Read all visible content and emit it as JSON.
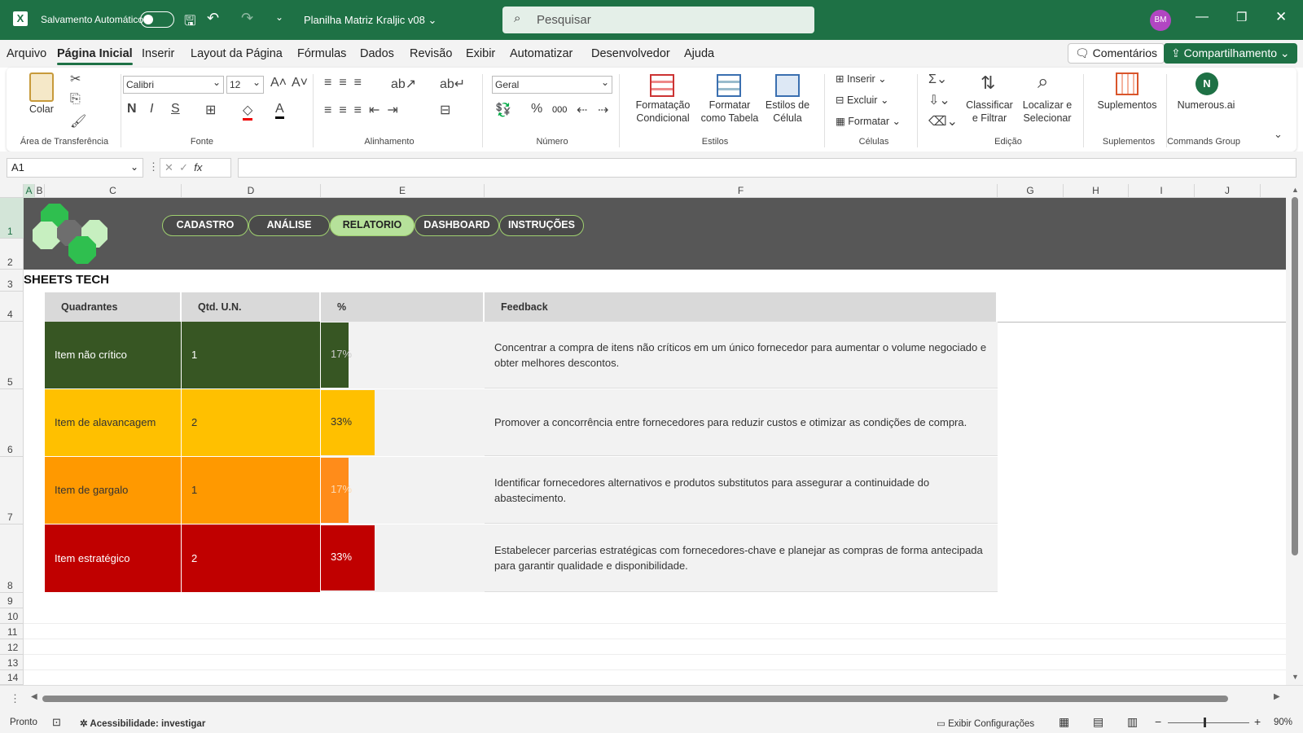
{
  "titlebar": {
    "autosave_label": "Salvamento Automático",
    "file_name": "Planilha Matriz Kraljic v08",
    "search_placeholder": "Pesquisar",
    "avatar_initials": "BM"
  },
  "tabs": [
    "Arquivo",
    "Página Inicial",
    "Inserir",
    "Layout da Página",
    "Fórmulas",
    "Dados",
    "Revisão",
    "Exibir",
    "Automatizar",
    "Desenvolvedor",
    "Ajuda"
  ],
  "top_buttons": {
    "comments": "Comentários",
    "share": "Compartilhamento"
  },
  "ribbon": {
    "clipboard": {
      "paste": "Colar",
      "label": "Área de Transferência"
    },
    "font": {
      "name": "Calibri",
      "size": "12",
      "label": "Fonte",
      "bold": "N",
      "italic": "I",
      "underline": "S"
    },
    "alignment": {
      "label": "Alinhamento"
    },
    "number": {
      "format": "Geral",
      "label": "Número",
      "percent": "%",
      "thousands": "000"
    },
    "styles": {
      "conditional": "Formatação Condicional",
      "table": "Formatar como Tabela",
      "cell_styles": "Estilos de Célula",
      "label": "Estilos"
    },
    "cells": {
      "insert": "Inserir",
      "delete": "Excluir",
      "format": "Formatar",
      "label": "Células"
    },
    "editing": {
      "sort": "Classificar e Filtrar",
      "find": "Localizar e Selecionar",
      "label": "Edição"
    },
    "addins": {
      "addins": "Suplementos",
      "label": "Suplementos"
    },
    "commands": {
      "numerous": "Numerous.ai",
      "label": "Commands Group"
    }
  },
  "formula_bar": {
    "name_box": "A1",
    "fx": "fx",
    "value": ""
  },
  "columns": [
    "A",
    "B",
    "C",
    "D",
    "E",
    "F",
    "G",
    "H",
    "I",
    "J"
  ],
  "rows": [
    "1",
    "2",
    "3",
    "4",
    "5",
    "6",
    "7",
    "8",
    "9",
    "10",
    "11",
    "12",
    "13",
    "14"
  ],
  "sheet": {
    "brand": "SHEETS TECH",
    "nav": [
      "CADASTRO",
      "ANÁLISE",
      "RELATORIO",
      "DASHBOARD",
      "INSTRUÇÕES"
    ],
    "active_nav": "RELATORIO",
    "headers": {
      "quadrant": "Quadrantes",
      "qty": "Qtd. U.N.",
      "pct": "%",
      "feedback": "Feedback"
    },
    "items": [
      {
        "name": "Item não crítico",
        "qty": "1",
        "pct": "17%",
        "pct_value": 17,
        "color": "#375623",
        "feedback": "Concentrar a compra de itens não críticos em um único fornecedor para aumentar o volume negociado e obter melhores descontos."
      },
      {
        "name": "Item de alavancagem",
        "qty": "2",
        "pct": "33%",
        "pct_value": 33,
        "color": "#ffc000",
        "feedback": "Promover a concorrência entre fornecedores para reduzir custos e otimizar as condições de compra."
      },
      {
        "name": "Item de gargalo",
        "qty": "1",
        "pct": "17%",
        "pct_value": 17,
        "color": "#ff9900",
        "feedback": "Identificar fornecedores alternativos e produtos substitutos para assegurar a continuidade do abastecimento."
      },
      {
        "name": "Item estratégico",
        "qty": "2",
        "pct": "33%",
        "pct_value": 33,
        "color": "#c00000",
        "feedback": "Estabelecer parcerias estratégicas com fornecedores-chave e planejar as compras de forma antecipada para garantir qualidade e disponibilidade."
      }
    ]
  },
  "status": {
    "ready": "Pronto",
    "accessibility": "Acessibilidade: investigar",
    "display_settings": "Exibir Configurações",
    "zoom": "90%"
  }
}
